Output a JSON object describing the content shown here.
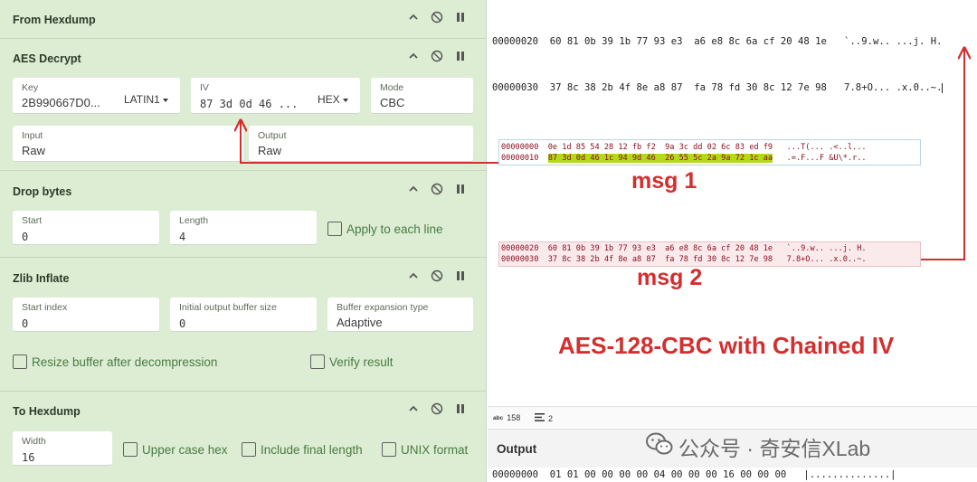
{
  "recipe": {
    "from_hexdump": {
      "title": "From Hexdump"
    },
    "aes_decrypt": {
      "title": "AES Decrypt",
      "key": {
        "label": "Key",
        "value": "2B990667D0...",
        "format": "LATIN1"
      },
      "iv": {
        "label": "IV",
        "value": "87 3d 0d 46 ...",
        "format": "HEX"
      },
      "mode": {
        "label": "Mode",
        "value": "CBC"
      },
      "input": {
        "label": "Input",
        "value": "Raw"
      },
      "output": {
        "label": "Output",
        "value": "Raw"
      }
    },
    "drop_bytes": {
      "title": "Drop bytes",
      "start": {
        "label": "Start",
        "value": "0"
      },
      "length": {
        "label": "Length",
        "value": "4"
      },
      "apply_each_line": "Apply to each line"
    },
    "zlib_inflate": {
      "title": "Zlib Inflate",
      "start_index": {
        "label": "Start index",
        "value": "0"
      },
      "initial_buffer": {
        "label": "Initial output buffer size",
        "value": "0"
      },
      "expansion_type": {
        "label": "Buffer expansion type",
        "value": "Adaptive"
      },
      "resize_buffer": "Resize buffer after decompression",
      "verify_result": "Verify result"
    },
    "to_hexdump": {
      "title": "To Hexdump",
      "width": {
        "label": "Width",
        "value": "16"
      },
      "upper_case": "Upper case hex",
      "include_final_length": "Include final length",
      "unix_format": "UNIX format"
    }
  },
  "top_hex": {
    "line1": "00000020  60 81 0b 39 1b 77 93 e3  a6 e8 8c 6a cf 20 48 1e   `..9.w.. ...j. H.",
    "line2": "00000030  37 8c 38 2b 4f 8e a8 87  fa 78 fd 30 8c 12 7e 98   7.8+O... .x.0..~."
  },
  "msg1": {
    "line1": "00000000  0e 1d 85 54 28 12 fb f2  9a 3c dd 02 6c 83 ed f9   ...T(... .<..l...",
    "line2_offset": "00000010  ",
    "line2_highlight": "87 3d 0d 46 1c 94 9d 46  26 55 5c 2a 9a 72 1c aa",
    "line2_ascii": "   .=.F...F &U\\*.r..",
    "label": "msg 1"
  },
  "msg2": {
    "line1": "00000020  60 81 0b 39 1b 77 93 e3  a6 e8 8c 6a cf 20 48 1e   `..9.w.. ...j. H.",
    "line2": "00000030  37 8c 38 2b 4f 8e a8 87  fa 78 fd 30 8c 12 7e 98   7.8+O... .x.0..~.",
    "label": "msg 2"
  },
  "caption": "AES-128-CBC with Chained IV",
  "status": {
    "length_icon": "abc",
    "length": "158",
    "lines": "2"
  },
  "output": {
    "title": "Output",
    "first_line": "00000000  01 01 00 00 00 00 04 00 00 00 16 00 00 00   |..............|"
  },
  "watermark": "公众号 · 奇安信XLab",
  "colors": {
    "recipe_bg": "#dcedd3",
    "annotation_red": "#d42e2e",
    "highlight": "#b5d81a",
    "checkbox_label": "#4a7a44"
  }
}
